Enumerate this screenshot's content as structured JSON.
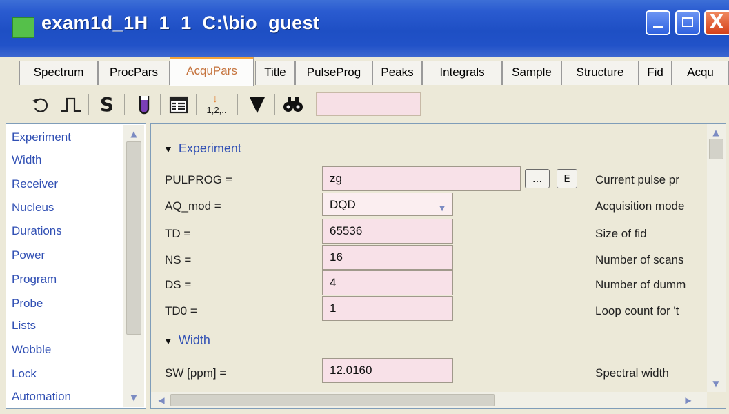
{
  "window": {
    "title": "exam1d_1H  1  1  C:\\bio  guest",
    "minimize_glyph": "",
    "close_glyph": "X"
  },
  "tabs": [
    {
      "label": "Spectrum",
      "active": false
    },
    {
      "label": "ProcPars",
      "active": false
    },
    {
      "label": "AcquPars",
      "active": true
    },
    {
      "label": "Title",
      "active": false
    },
    {
      "label": "PulseProg",
      "active": false
    },
    {
      "label": "Peaks",
      "active": false
    },
    {
      "label": "Integrals",
      "active": false
    },
    {
      "label": "Sample",
      "active": false
    },
    {
      "label": "Structure",
      "active": false
    },
    {
      "label": "Fid",
      "active": false
    },
    {
      "label": "Acqu",
      "active": false
    }
  ],
  "toolbar": {
    "undo_icon": "undo-icon",
    "pulse_icon": "pulse-program-icon",
    "s_label": "S",
    "tube_icon": "sample-tube-icon",
    "table_icon": "table-icon",
    "sort_label": "1,2,..",
    "filter_icon": "filter-icon",
    "find_icon": "binoculars-icon",
    "search_value": ""
  },
  "sidebar": {
    "items": [
      "Experiment",
      "Width",
      "Receiver",
      "Nucleus",
      "Durations",
      "Power",
      "Program",
      "Probe",
      "Lists",
      "Wobble",
      "Lock",
      "Automation"
    ]
  },
  "sections": {
    "experiment": "Experiment",
    "width": "Width"
  },
  "params": {
    "pulprog": {
      "label": "PULPROG =",
      "value": "zg",
      "browse": "...",
      "edit": "E",
      "desc": "Current pulse pr"
    },
    "aq_mod": {
      "label": "AQ_mod =",
      "value": "DQD",
      "desc": "Acquisition mode"
    },
    "td": {
      "label": "TD =",
      "value": "65536",
      "desc": "Size of fid"
    },
    "ns": {
      "label": "NS =",
      "value": "16",
      "desc": "Number of scans"
    },
    "ds": {
      "label": "DS =",
      "value": "4",
      "desc": "Number of dumm"
    },
    "td0": {
      "label": "TD0 =",
      "value": "1",
      "desc": "Loop count for 't"
    },
    "sw": {
      "label": "SW [ppm] =",
      "value": "12.0160",
      "desc": "Spectral width"
    }
  },
  "colors": {
    "titlebar": "#2152c8",
    "active_tab_text": "#c5733d",
    "active_tab_accent": "#f5a53a",
    "field_bg": "#f8e1e8",
    "link_text": "#3150b4"
  }
}
